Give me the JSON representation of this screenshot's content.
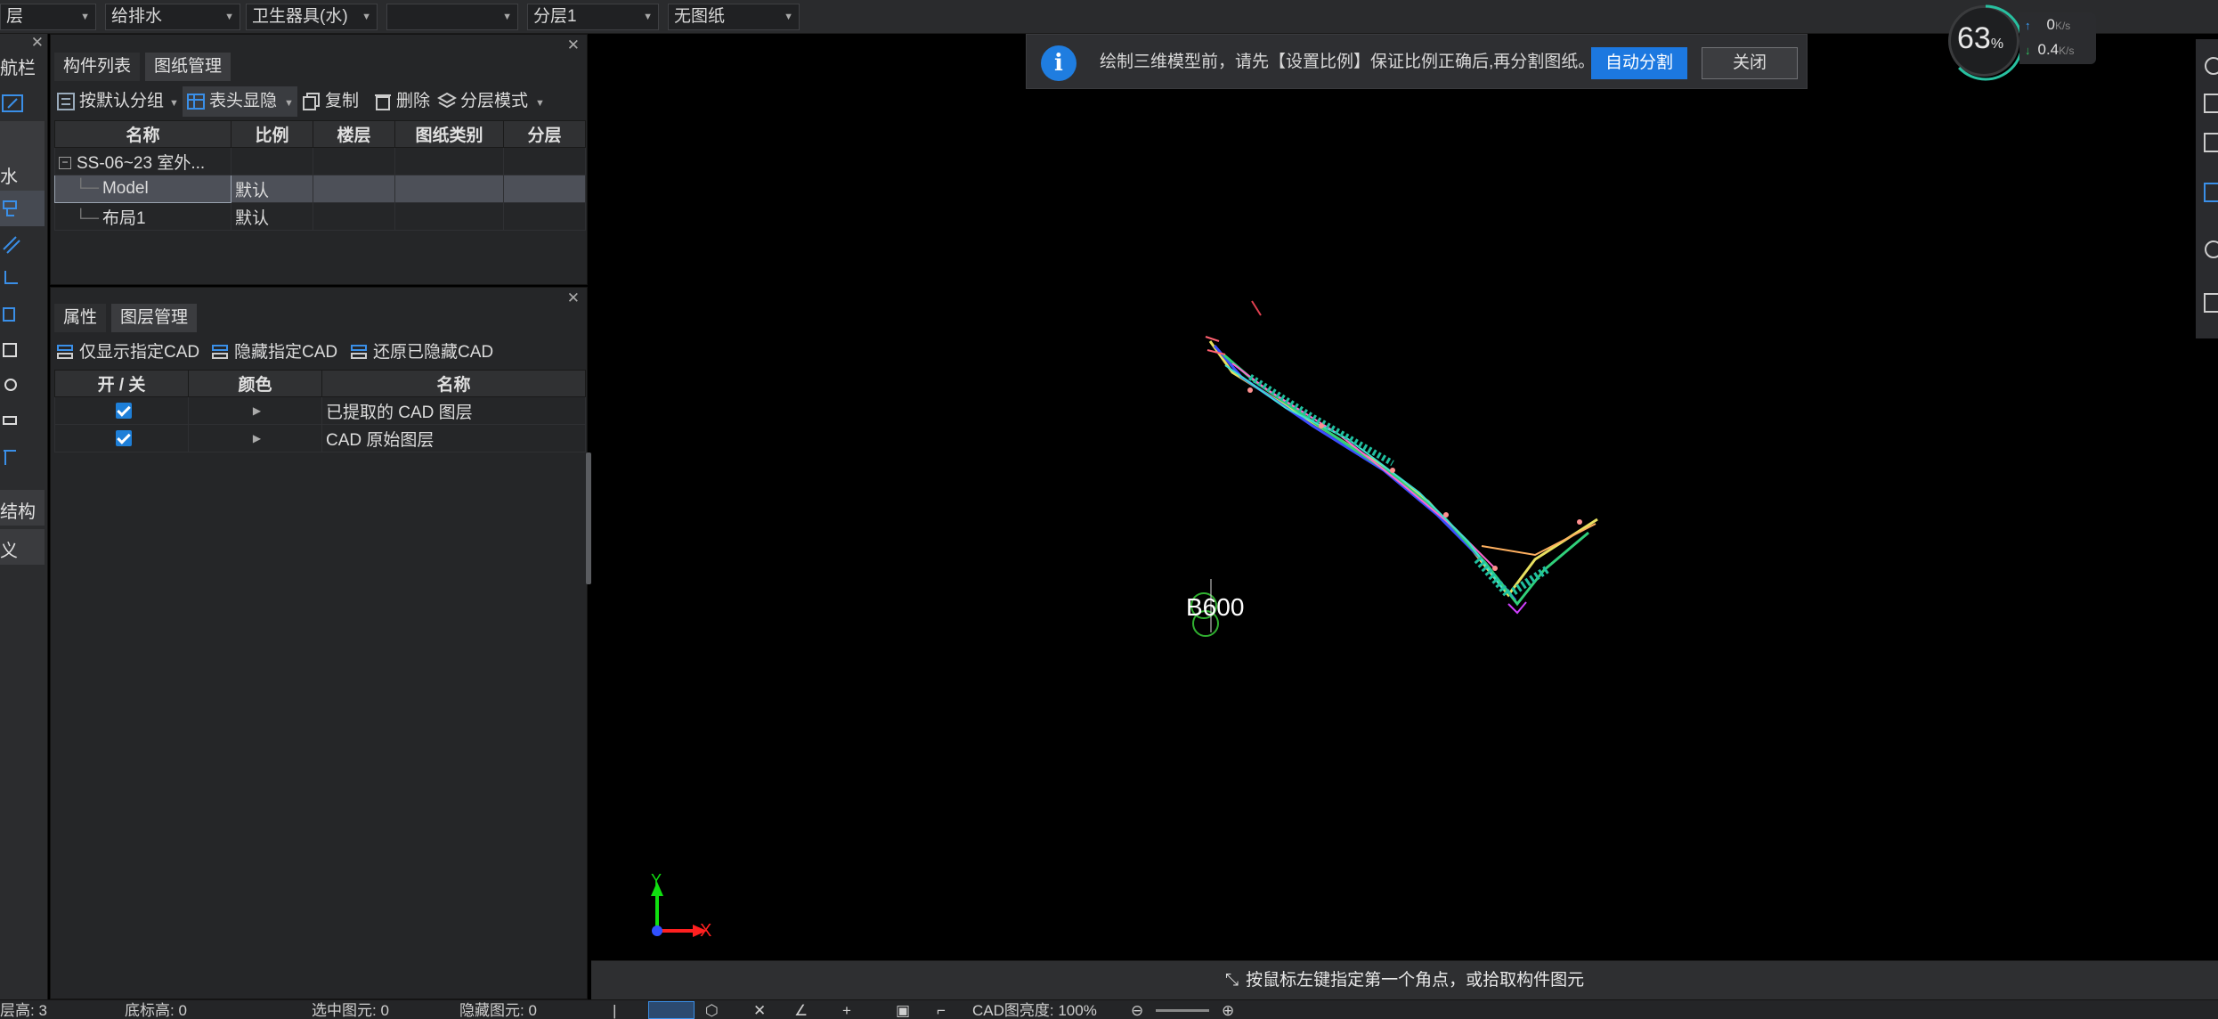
{
  "topbar": {
    "dropdowns": [
      "层",
      "给排水",
      "卫生器具(水)",
      "",
      "分层1",
      "无图纸"
    ]
  },
  "left_toolbar": {
    "labels": [
      "航栏",
      "水",
      "结构",
      "义"
    ]
  },
  "component_panel": {
    "tabs": [
      "构件列表",
      "图纸管理"
    ],
    "toolbar": {
      "group_label": "按默认分组",
      "header_label": "表头显隐",
      "copy_label": "复制",
      "delete_label": "删除",
      "layer_mode_label": "分层模式"
    },
    "columns": [
      "名称",
      "比例",
      "楼层",
      "图纸类别",
      "分层"
    ],
    "rows": [
      {
        "name": "SS-06~23  室外...",
        "scale": "",
        "floor": "",
        "category": "",
        "layer": ""
      },
      {
        "name": "Model",
        "scale": "默认",
        "floor": "",
        "category": "",
        "layer": ""
      },
      {
        "name": "布局1",
        "scale": "默认",
        "floor": "",
        "category": "",
        "layer": ""
      }
    ]
  },
  "layer_panel": {
    "tabs": [
      "属性",
      "图层管理"
    ],
    "toolbar": {
      "show_only_label": "仅显示指定CAD",
      "hide_label": "隐藏指定CAD",
      "restore_label": "还原已隐藏CAD"
    },
    "columns": [
      "开 / 关",
      "颜色",
      "名称"
    ],
    "rows": [
      {
        "checked": true,
        "name": "已提取的 CAD 图层"
      },
      {
        "checked": true,
        "name": "CAD 原始图层"
      }
    ]
  },
  "notification": {
    "message": "绘制三维模型前，请先【设置比例】保证比例正确后,再分割图纸。",
    "primary_button": "自动分割",
    "secondary_button": "关闭"
  },
  "performance": {
    "percent": "63",
    "percent_unit": "%",
    "upload": "0",
    "download": "0.4",
    "rate_unit": "K/s"
  },
  "viewport": {
    "axis_y": "Y",
    "axis_x": "X",
    "drawing_label": "B600"
  },
  "hint_bar": {
    "text": "按鼠标左键指定第一个角点，或拾取构件图元"
  },
  "status_bar": {
    "item0": "层高: 3",
    "item1": "底标高: 0",
    "item2": "选中图元: 0",
    "item3": "隐藏图元: 0",
    "cad_brightness_label": "CAD图亮度: 100%"
  },
  "colors": {
    "accent": "#1c78e0",
    "panel_bg": "#252628",
    "viewport_bg": "#000000"
  }
}
